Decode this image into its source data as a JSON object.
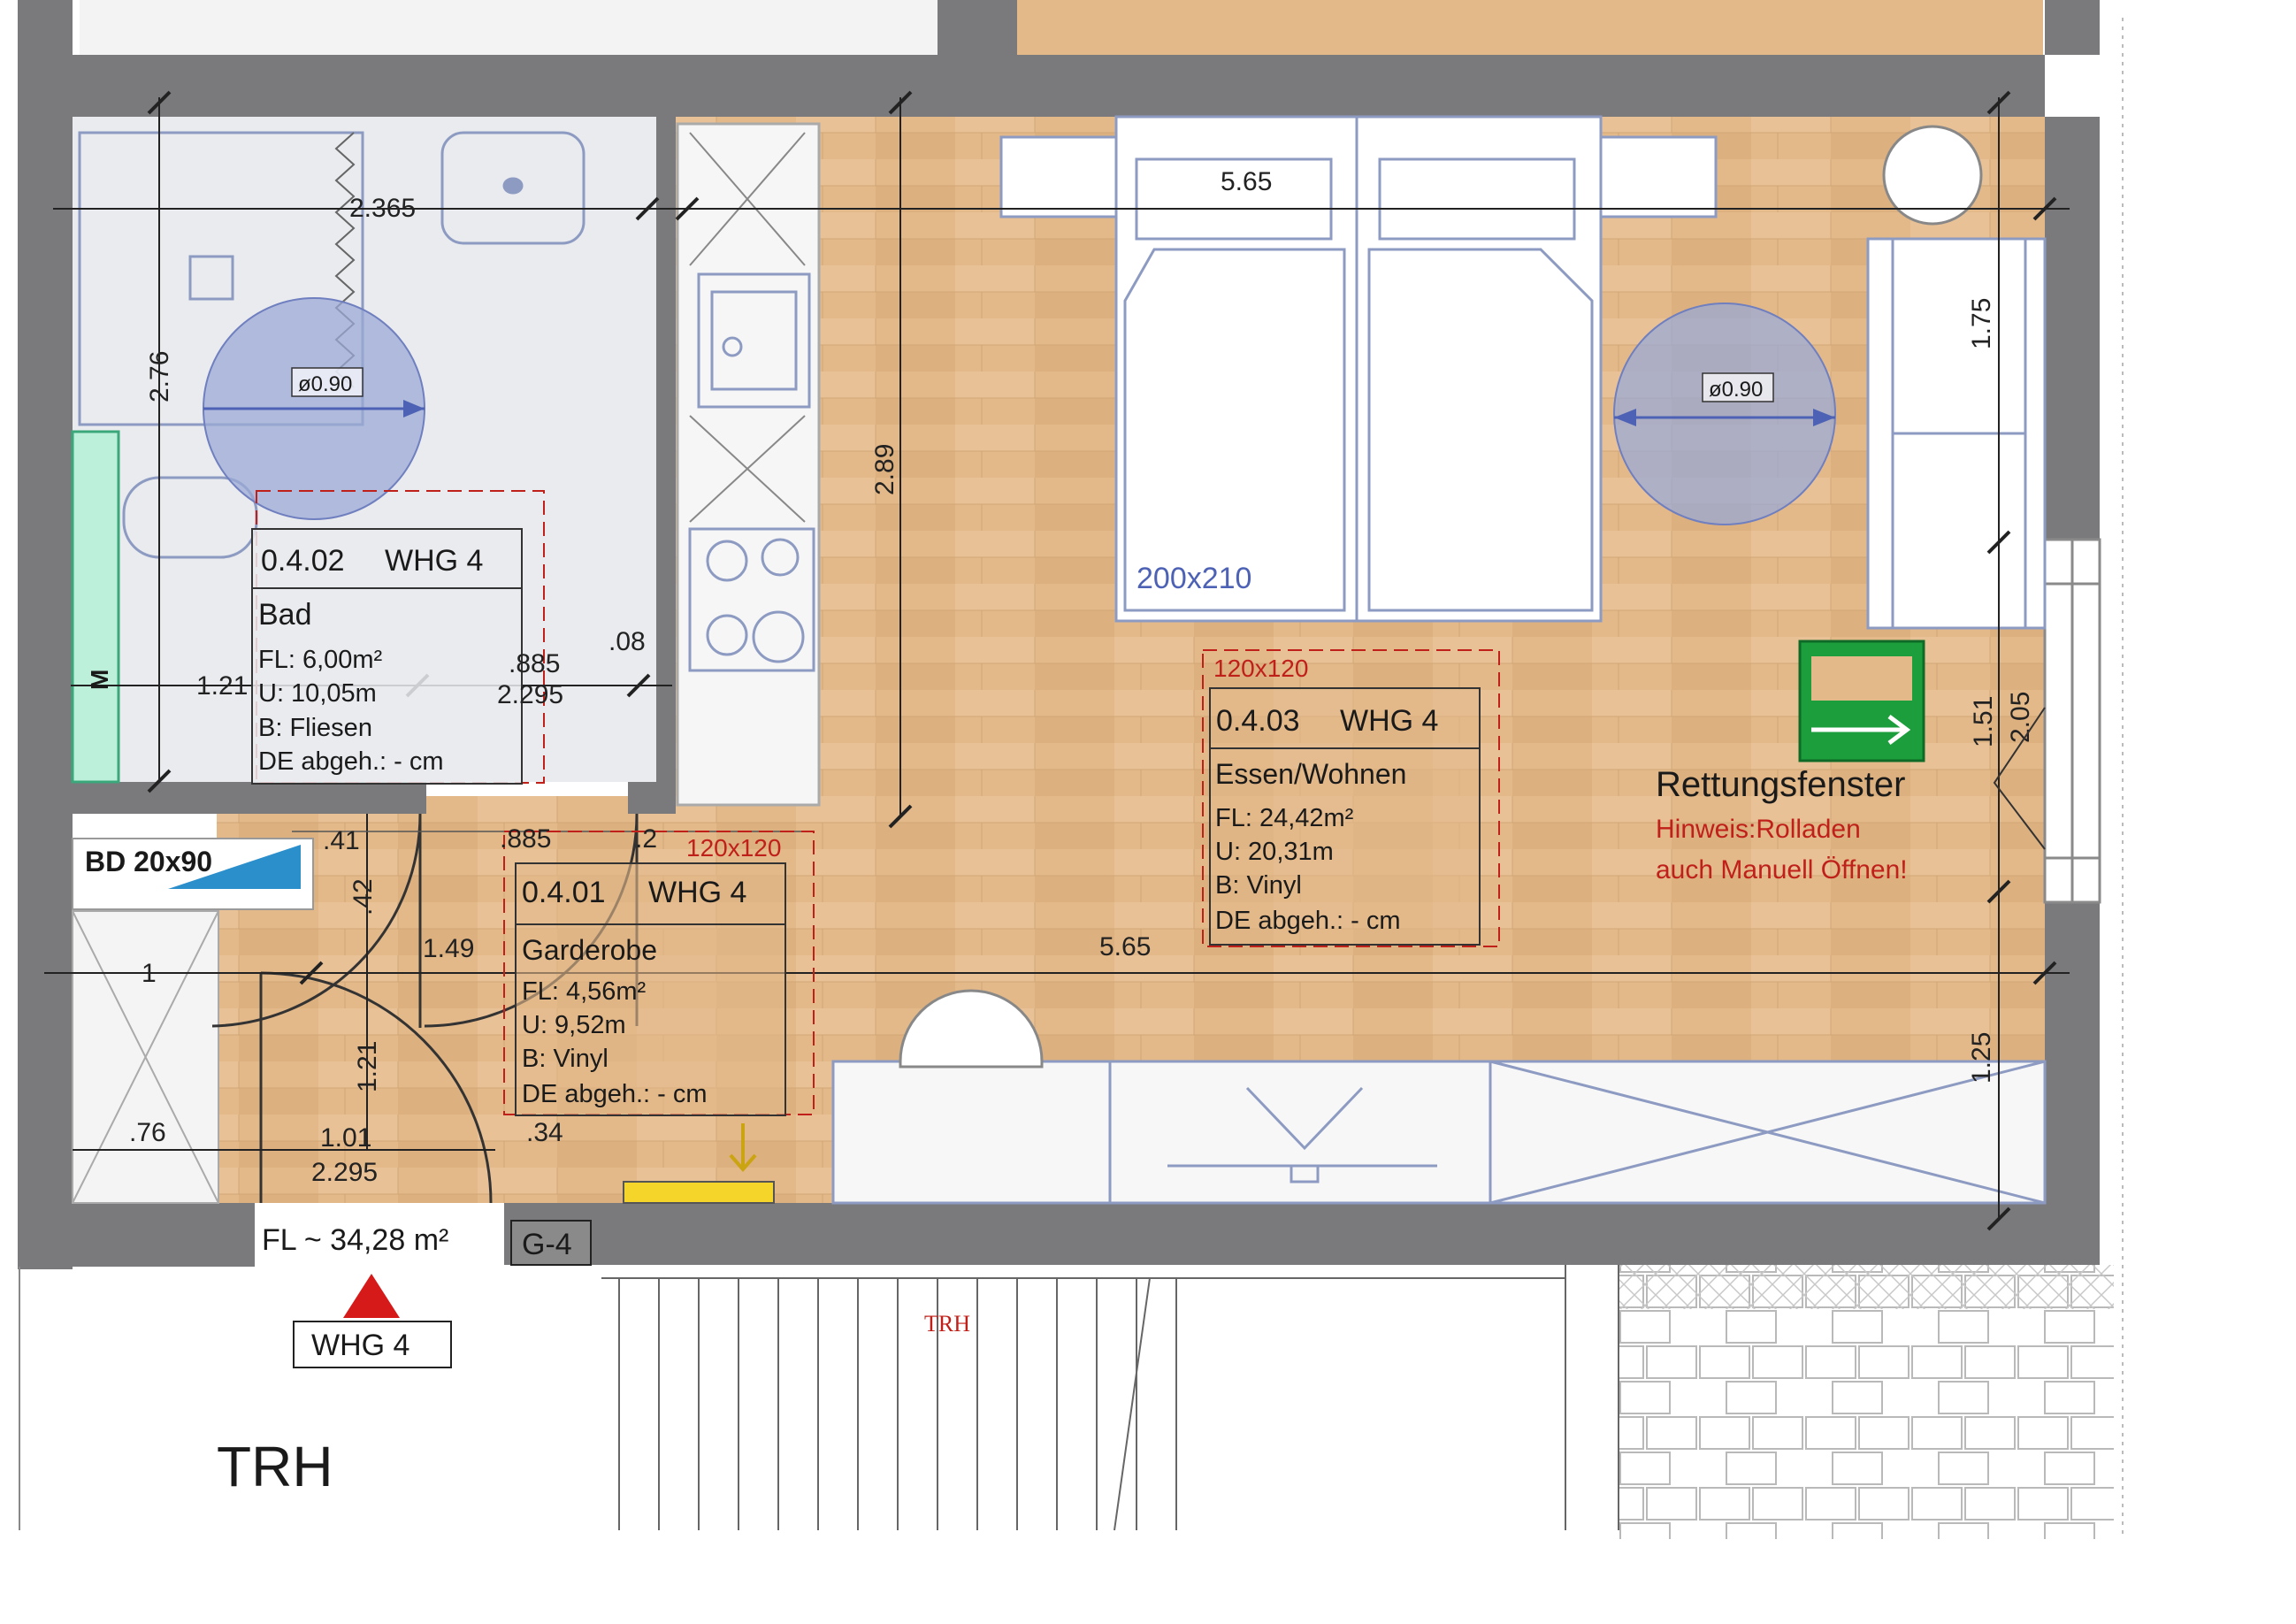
{
  "rooms": [
    {
      "id": "0.4.02",
      "unit": "WHG 4",
      "name": "Bad",
      "fl": "FL: 6,00m²",
      "u": "U:  10,05m",
      "b": "B: Fliesen",
      "de": "DE abgeh.: - cm"
    },
    {
      "id": "0.4.03",
      "unit": "WHG 4",
      "name": "Essen/Wohnen",
      "fl": "FL: 24,42m²",
      "u": "U:  20,31m",
      "b": "B:  Vinyl",
      "de": "DE abgeh.: - cm"
    },
    {
      "id": "0.4.01",
      "unit": "WHG 4",
      "name": "Garderobe",
      "fl": "FL: 4,56m²",
      "u": "U:  9,52m",
      "b": "B:  Vinyl",
      "de": "DE abgeh.: - cm"
    }
  ],
  "dimensions": {
    "bath_width": "2.365",
    "bath_height": "2.76",
    "bath_lower_a": "1.21",
    "bath_lower_b": "2.295",
    "bath_lower_c": ".885",
    "bath_lower_d": ".08",
    "living_width_top": "5.65",
    "living_height": "2.89",
    "living_width_bottom": "5.65",
    "right_a": "1.75",
    "right_b": "1.51",
    "right_c": "2.05",
    "right_d": "1.25",
    "hall_a": ".41",
    "hall_b": ".885",
    "hall_c": ".2",
    "hall_d": ".42",
    "hall_e": "1.49",
    "hall_f": "1",
    "hall_g": "1.21",
    "hall_h": ".76",
    "hall_i": "1.01",
    "hall_j": "2.295",
    "hall_k": ".34"
  },
  "annotations": {
    "turn_circle_left": "ø0.90",
    "turn_circle_right": "ø0.90",
    "bed_size": "200x210",
    "clear_area_living": "120x120",
    "clear_area_hall": "120x120",
    "shower_tray": "BD 20x90",
    "meter_mark": "M",
    "rescue_title": "Rettungsfenster",
    "rescue_note_1": "Hinweis:Rolladen",
    "rescue_note_2": "auch Manuell Öffnen!",
    "total_area": "FL ~  34,28 m²",
    "entrance_label": "WHG 4",
    "storage_label": "G-4",
    "stair_label": "TRH",
    "stair_label_small": "TRH"
  },
  "colors": {
    "wall": "#7a7a7d",
    "wood": "#e3b98a",
    "tile": "#e9ebee",
    "furniture_line": "#8d9bc2",
    "exit_sign": "#1c9e3c",
    "red_text": "#c0201a",
    "turn_circle": "#9ba9d6"
  }
}
